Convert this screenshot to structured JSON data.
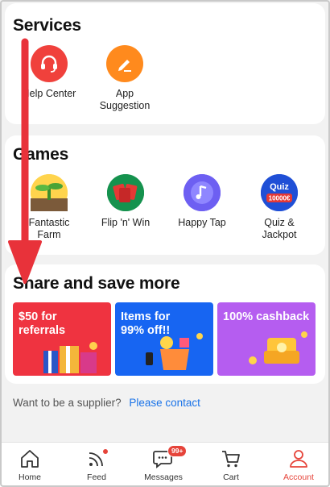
{
  "services": {
    "title": "Services",
    "items": [
      {
        "label": "Help Center",
        "icon": "headset-icon",
        "color": "#f0413c"
      },
      {
        "label": "App Suggestion",
        "icon": "pencil-icon",
        "color": "#ff8a1d"
      }
    ]
  },
  "games": {
    "title": "Games",
    "items": [
      {
        "label": "Fantastic Farm",
        "icon": "plant-icon"
      },
      {
        "label": "Flip 'n' Win",
        "icon": "cards-icon"
      },
      {
        "label": "Happy Tap",
        "icon": "music-note-icon"
      },
      {
        "label": "Quiz & Jackpot",
        "icon": "quiz-icon",
        "badge_top": "Quiz",
        "badge_bottom": "10000€"
      }
    ]
  },
  "share": {
    "title": "Share and save more",
    "promos": [
      {
        "text_line1": "$50 for",
        "text_line2": "referrals",
        "color": "#ef3340"
      },
      {
        "text_line1": "Items for",
        "text_line2": "99% off!!",
        "color": "#1765f2"
      },
      {
        "text_line1": "100% cashback",
        "text_line2": "",
        "color": "#b55df0"
      }
    ]
  },
  "supplier": {
    "prompt": "Want to be a supplier?",
    "link": "Please contact"
  },
  "tabbar": {
    "tabs": [
      {
        "label": "Home",
        "icon": "home-icon"
      },
      {
        "label": "Feed",
        "icon": "feed-icon"
      },
      {
        "label": "Messages",
        "icon": "chat-icon",
        "badge": "99+"
      },
      {
        "label": "Cart",
        "icon": "cart-icon"
      },
      {
        "label": "Account",
        "icon": "person-icon",
        "active": true
      }
    ]
  },
  "colors": {
    "accent": "#e6443a",
    "link": "#1a73e8",
    "annotation_arrow": "#e8323a"
  }
}
